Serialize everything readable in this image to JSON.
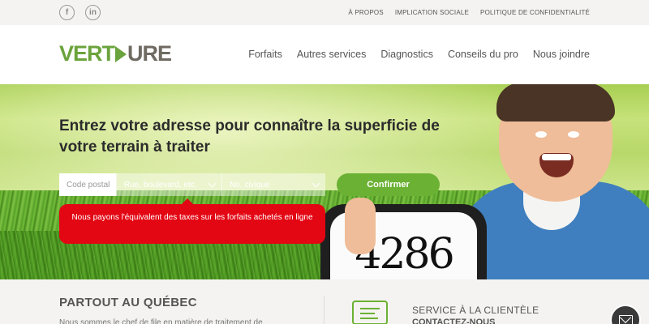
{
  "topbar": {
    "social": [
      {
        "icon": "facebook-icon",
        "glyph": "f"
      },
      {
        "icon": "linkedin-icon",
        "glyph": "in"
      }
    ],
    "links": [
      "À PROPOS",
      "IMPLICATION SOCIALE",
      "POLITIQUE DE CONFIDENTIALITÉ"
    ]
  },
  "header": {
    "logo": {
      "part1": "VERT",
      "part2": "URE",
      "leaf_color": "#6ba33c"
    },
    "nav": [
      "Forfaits",
      "Autres services",
      "Diagnostics",
      "Conseils du pro",
      "Nous joindre"
    ]
  },
  "hero": {
    "headline": "Entrez votre adresse pour connaître la superficie de votre terrain à traiter",
    "form": {
      "postal_placeholder": "Code postal",
      "street_placeholder": "Rue, boulevard, etc.",
      "civic_placeholder": "No. civique",
      "confirm_label": "Confirmer"
    },
    "tax_notice": "Nous payons l'équivalent des taxes sur les forfaits achetés en ligne",
    "sign_number": "4286"
  },
  "bottom": {
    "partout_title": "PARTOUT AU QUÉBEC",
    "partout_text": "Nous sommes le chef de file en matière de traitement de pelouse",
    "service_title": "SERVICE À LA CLIENTÈLE",
    "service_sub": "CONTACTEZ-NOUS"
  },
  "colors": {
    "brand_green": "#6bb134",
    "alert_red": "#e30613",
    "logo_grey": "#6f6a62"
  }
}
